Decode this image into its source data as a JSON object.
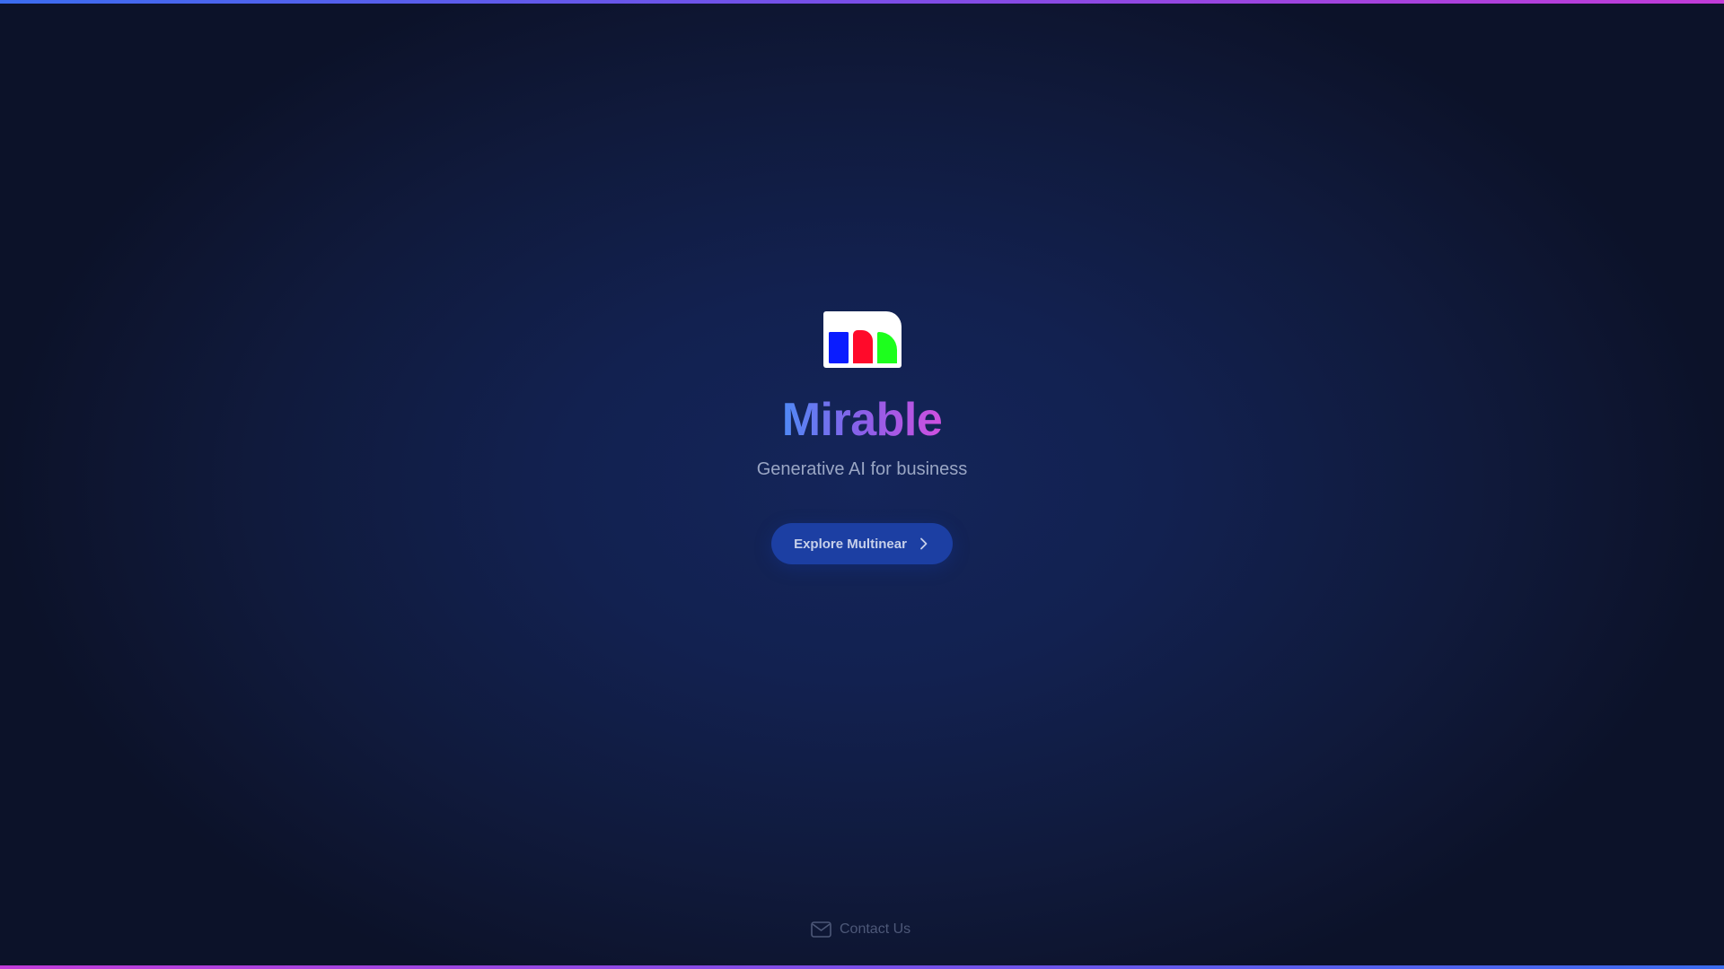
{
  "brand": {
    "name": "Mirable",
    "tagline": "Generative AI for business",
    "logo_icon": "tri-color-bars-logo",
    "logo_colors": [
      "#0a1cff",
      "#ff0a2a",
      "#1dff1d"
    ]
  },
  "cta": {
    "label": "Explore Multinear",
    "icon": "chevron-right-icon"
  },
  "footer": {
    "contact_label": "Contact Us",
    "contact_icon": "envelope-icon"
  },
  "colors": {
    "background": "#121f4d",
    "button": "#1c3fa3",
    "title_gradient": [
      "#4f8af5",
      "#8a5fe8",
      "#d050e0"
    ]
  }
}
